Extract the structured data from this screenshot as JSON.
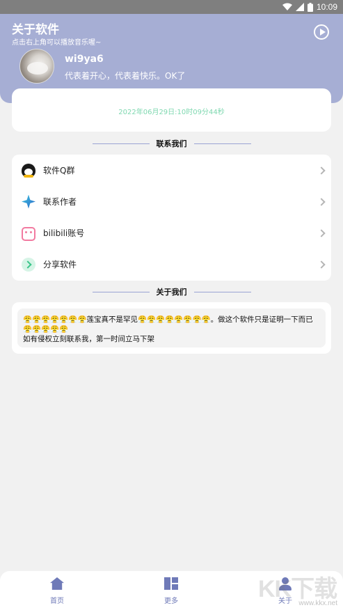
{
  "status_bar": {
    "time": "10:09",
    "icons": [
      "wifi-icon",
      "signal-icon",
      "battery-icon"
    ]
  },
  "header": {
    "title": "关于软件",
    "subtitle": "点击右上角可以播放音乐喔~",
    "play_icon": "play-circle-icon",
    "username": "wi9ya6",
    "motto": "代表着开心，代表着快乐。OK了"
  },
  "date_card": {
    "text": "2022年06月29日:10时09分44秒"
  },
  "contact_section": {
    "title": "联系我们",
    "items": [
      {
        "label": "软件Q群",
        "icon": "qq-penguin-icon"
      },
      {
        "label": "联系作者",
        "icon": "sparkle-star-icon"
      },
      {
        "label": "bilibili账号",
        "icon": "bilibili-tv-icon"
      },
      {
        "label": "分享软件",
        "icon": "share-arrow-icon"
      }
    ]
  },
  "about_section": {
    "title": "关于我们",
    "text_line1": "😤😤😤😤😤😤😤莲宝真不是罕见😤😤😤😤😤😤😤😤。做这个软件只是证明一下而已😤😤😤😤😤",
    "text_line2": "如有侵权立刻联系我，第一时间立马下架"
  },
  "tab_bar": {
    "tabs": [
      {
        "label": "首页",
        "icon": "home-icon"
      },
      {
        "label": "更多",
        "icon": "grid-icon"
      },
      {
        "label": "关于",
        "icon": "user-icon"
      }
    ]
  },
  "watermark": {
    "logo": "KK下载",
    "url": "www.kkx.net"
  },
  "colors": {
    "header_bg": "#a6aed4",
    "accent": "#6f7ab8",
    "date_text": "#7fd8b0",
    "page_bg": "#f1f1f1"
  }
}
